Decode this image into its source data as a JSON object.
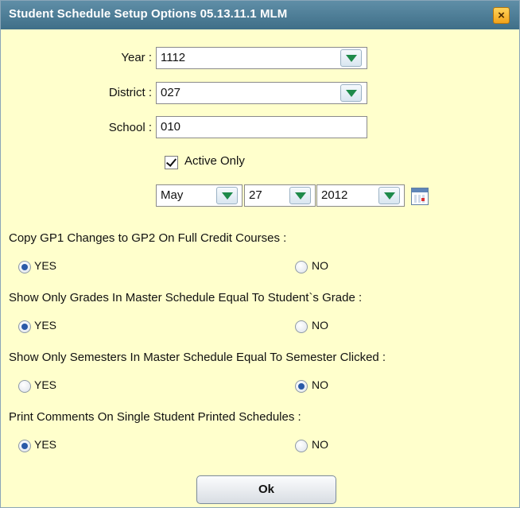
{
  "dialog": {
    "title": "Student Schedule Setup Options 05.13.11.1 MLM",
    "close_icon": "close-icon"
  },
  "fields": {
    "year": {
      "label": "Year :",
      "value": "1112"
    },
    "district": {
      "label": "District :",
      "value": "027"
    },
    "school": {
      "label": "School :",
      "value": "010"
    }
  },
  "active_only": {
    "label": "Active Only",
    "checked": true
  },
  "date": {
    "month": "May",
    "day": "27",
    "year": "2012",
    "calendar_icon": "calendar-icon"
  },
  "options": [
    {
      "question": "Copy GP1 Changes to GP2 On Full Credit Courses :",
      "yes": "YES",
      "no": "NO",
      "selected": "YES"
    },
    {
      "question": "Show Only Grades In Master Schedule Equal To Student`s Grade :",
      "yes": "YES",
      "no": "NO",
      "selected": "YES"
    },
    {
      "question": "Show Only Semesters In Master Schedule Equal To Semester Clicked :",
      "yes": "YES",
      "no": "NO",
      "selected": "NO"
    },
    {
      "question": "Print Comments On Single Student Printed Schedules :",
      "yes": "YES",
      "no": "NO",
      "selected": "YES"
    }
  ],
  "ok_label": "Ok",
  "colors": {
    "title_bar": "#4a7b94",
    "background": "#ffffcc",
    "radio_selected": "#2a5aa8",
    "dropdown_arrow": "#1e8a4a"
  }
}
